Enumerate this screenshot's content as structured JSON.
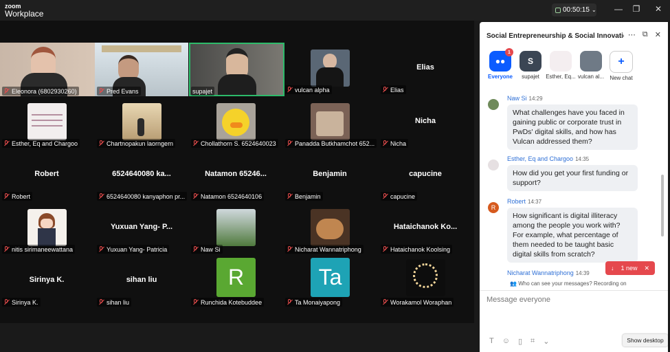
{
  "app": {
    "brand_small": "zoom",
    "brand": "Workplace",
    "timer": "00:50:15"
  },
  "window_controls": {
    "minimize": "—",
    "restore": "❐",
    "close": "✕"
  },
  "participants": [
    {
      "label": "Eleonora (6802930260)",
      "video": "photo"
    },
    {
      "label": "Pred Evans",
      "video": "photo"
    },
    {
      "label": "supajet",
      "video": "photo"
    },
    {
      "label": "vulcan alpha",
      "video": "photo"
    },
    {
      "label": "Elias",
      "big": "Elias"
    },
    {
      "label": "Esther, Eq and Chargoo",
      "video": "photo"
    },
    {
      "label": "Chartnopakun laorngern",
      "video": "photo"
    },
    {
      "label": "Chollathorn S. 6524640023",
      "video": "duck"
    },
    {
      "label": "Panadda Butkhamchot 652...",
      "video": "photo"
    },
    {
      "label": "Nicha",
      "big": "Nicha"
    },
    {
      "label": "Robert",
      "big": "Robert"
    },
    {
      "label": "6524640080 kanyaphon pr...",
      "big": "6524640080 ka..."
    },
    {
      "label": "Natamon 6524640106",
      "big": "Natamon 65246..."
    },
    {
      "label": "Benjamin",
      "big": "Benjamin"
    },
    {
      "label": "capucine",
      "big": "capucine"
    },
    {
      "label": "nitis sirimaneewattana",
      "video": "cartoon"
    },
    {
      "label": "Yuxuan Yang- Patricia",
      "big": "Yuxuan Yang- P..."
    },
    {
      "label": "Naw Si",
      "video": "landscape"
    },
    {
      "label": "Nicharat Wannatriphong",
      "video": "capybara"
    },
    {
      "label": "Hataichanok Koolsing",
      "big": "Hataichanok Ko..."
    },
    {
      "label": "Sirinya K.",
      "big": "Sirinya K."
    },
    {
      "label": "sihan liu",
      "big": "sihan liu"
    },
    {
      "label": "Runchida Kotebuddee",
      "letter": "R",
      "color": "#5aa832"
    },
    {
      "label": "Ta Monaiyapong",
      "letter": "Ta",
      "color": "#1ea3b5"
    },
    {
      "label": "Worakamol Woraphan",
      "video": "ferris"
    }
  ],
  "chat": {
    "title": "Social Entrepreneurship & Social Innovatio...",
    "recipients": [
      {
        "label": "Everyone",
        "badge": "1"
      },
      {
        "label": "supajet",
        "initial": "S"
      },
      {
        "label": "Esther, Eq..."
      },
      {
        "label": "vulcan al..."
      },
      {
        "label": "New chat"
      }
    ],
    "messages": [
      {
        "name": "Naw Si",
        "time": "14:29",
        "text": "What challenges have you faced in gaining public or corporate trust in PwDs' digital skills, and how has Vulcan addressed them?"
      },
      {
        "name": "Esther, Eq and Chargoo",
        "time": "14:35",
        "text": "How did you get your first funding or support?"
      },
      {
        "name": "Robert",
        "time": "14:37",
        "initial": "R",
        "text": "How significant is digital illiteracy among the people you work with? For example, what percentage of them needed to be taught basic digital skills from scratch?"
      },
      {
        "name": "Nicharat Wannatriphong",
        "time": "14:39"
      }
    ],
    "new_pill": "1 new",
    "visibility": "Who can see your messages? Recording on",
    "input_placeholder": "Message everyone"
  },
  "show_desktop": "Show desktop"
}
